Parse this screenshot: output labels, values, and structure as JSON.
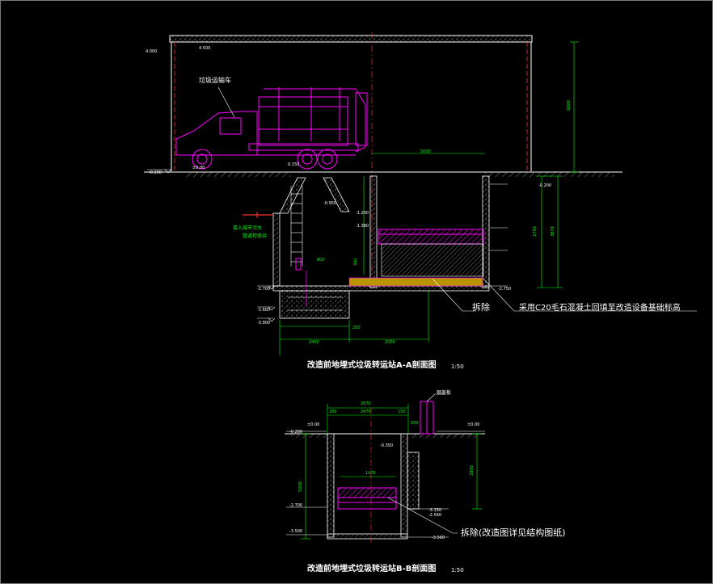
{
  "section_aa": {
    "title": "改造前地埋式垃圾转运站A-A剖面图",
    "scale": "1:50",
    "truck_label": "垃圾运输车",
    "note_remove": "拆除",
    "note_fill": "采用C20毛石混凝土回填至改造设备基础标高",
    "pipe_label_1": "接入城市污水",
    "pipe_label_2": "管道检修井",
    "elevations": [
      "4.000",
      "4.500",
      "±0.00",
      "-0.200",
      "-1.200",
      "-1.380",
      "-0.950",
      "-2.750",
      "-2.700",
      "-3.900",
      "-3.600",
      "-0.200",
      "0.150"
    ],
    "dims": [
      "5000",
      "6800",
      "2400",
      "2000",
      "3870",
      "2750",
      "200",
      "300",
      "800"
    ]
  },
  "section_bb": {
    "title": "改造前地埋式垃圾转运站B-B剖面图",
    "scale": "1:50",
    "note_remove": "拆除(改造图详见结构图纸)",
    "cover_label": "钢盖板",
    "elevations": [
      "±0.00",
      "-0.200",
      "-0.350",
      "-2.700",
      "-2.560",
      "-3.150",
      "-3.500",
      "-3.560",
      "±0.00"
    ],
    "dims": [
      "2870",
      "2470",
      "200",
      "150",
      "1470",
      "500",
      "5000",
      "2800"
    ]
  },
  "colors": {
    "background": "#000000",
    "lines": "#ffffff",
    "dimensions": "#00ff00",
    "equipment": "#ff00ff",
    "axis": "#ff3333",
    "hatch": "#c8c8c8"
  }
}
